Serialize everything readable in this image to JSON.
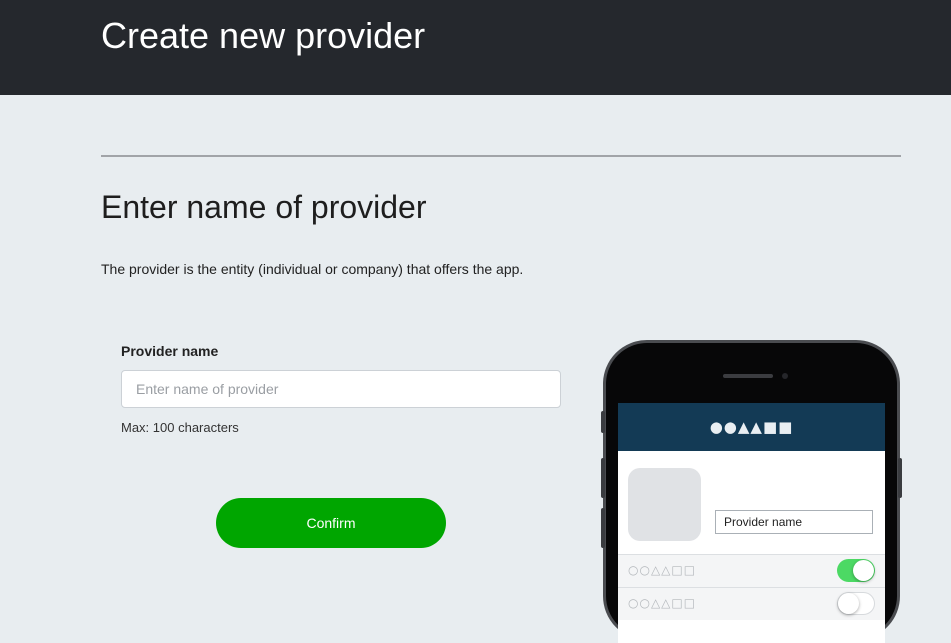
{
  "header": {
    "title": "Create new provider"
  },
  "section": {
    "title": "Enter name of provider",
    "description": "The provider is the entity (individual or company) that offers the app."
  },
  "form": {
    "label": "Provider name",
    "placeholder": "Enter name of provider",
    "value": "",
    "help": "Max: 100 characters",
    "confirm_label": "Confirm"
  },
  "preview": {
    "header_glyphs": "●●▲▲■■",
    "provider_name": "Provider name",
    "rows": [
      {
        "glyphs": "○○△△□□",
        "toggle": "on"
      },
      {
        "glyphs": "○○△△□□",
        "toggle": "off"
      }
    ]
  },
  "colors": {
    "topbar": "#25282d",
    "page_background": "#e8edf0",
    "confirm_button": "#00a600",
    "app_header": "#133a55",
    "toggle_on": "#4cd964"
  }
}
